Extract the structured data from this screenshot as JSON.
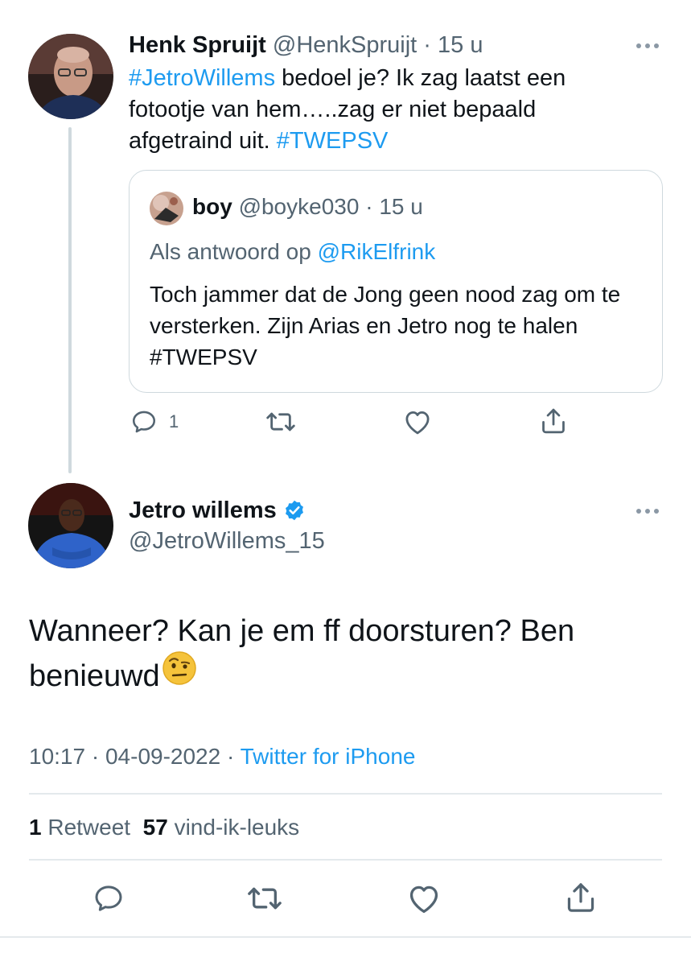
{
  "reply_tweet": {
    "author_name": "Henk Spruijt",
    "author_handle": "@HenkSpruijt",
    "separator": "·",
    "time_ago": "15 u",
    "body_hashtag_1": "#JetroWillems",
    "body_text": " bedoel je? Ik zag laatst een fotootje van hem…..zag er niet bepaald afgetraind uit. ",
    "body_hashtag_2": "#TWEPSV",
    "more_icon": "more-dots-icon",
    "quote": {
      "author_name": "boy",
      "author_handle": "@boyke030",
      "separator": "·",
      "time_ago": "15 u",
      "reply_prefix": "Als antwoord op ",
      "reply_to": "@RikElfrink",
      "text": "Toch jammer dat de Jong geen nood zag om te versterken. Zijn Arias en Jetro nog te halen #TWEPSV"
    },
    "actions": {
      "reply_icon": "reply-icon",
      "reply_count": "1",
      "retweet_icon": "retweet-icon",
      "like_icon": "heart-icon",
      "share_icon": "share-icon"
    }
  },
  "main_tweet": {
    "author_name": "Jetro willems",
    "verified_icon": "verified-badge-icon",
    "author_handle": "@JetroWillems_15",
    "text": "Wanneer? Kan je em ff doorsturen? Ben benieuwd",
    "emoji": "face-with-raised-eyebrow-emoji",
    "time": "10:17",
    "separator": "·",
    "date": "04-09-2022",
    "source": "Twitter for iPhone",
    "retweet_count": "1",
    "retweet_label": "Retweet",
    "like_count": "57",
    "like_label": "vind-ik-leuks",
    "actions": {
      "reply_icon": "reply-icon",
      "retweet_icon": "retweet-icon",
      "like_icon": "heart-icon",
      "share_icon": "share-icon"
    }
  },
  "colors": {
    "link": "#1d9bf0",
    "text": "#0f1419",
    "muted": "#536471",
    "border": "#cfd9de"
  }
}
